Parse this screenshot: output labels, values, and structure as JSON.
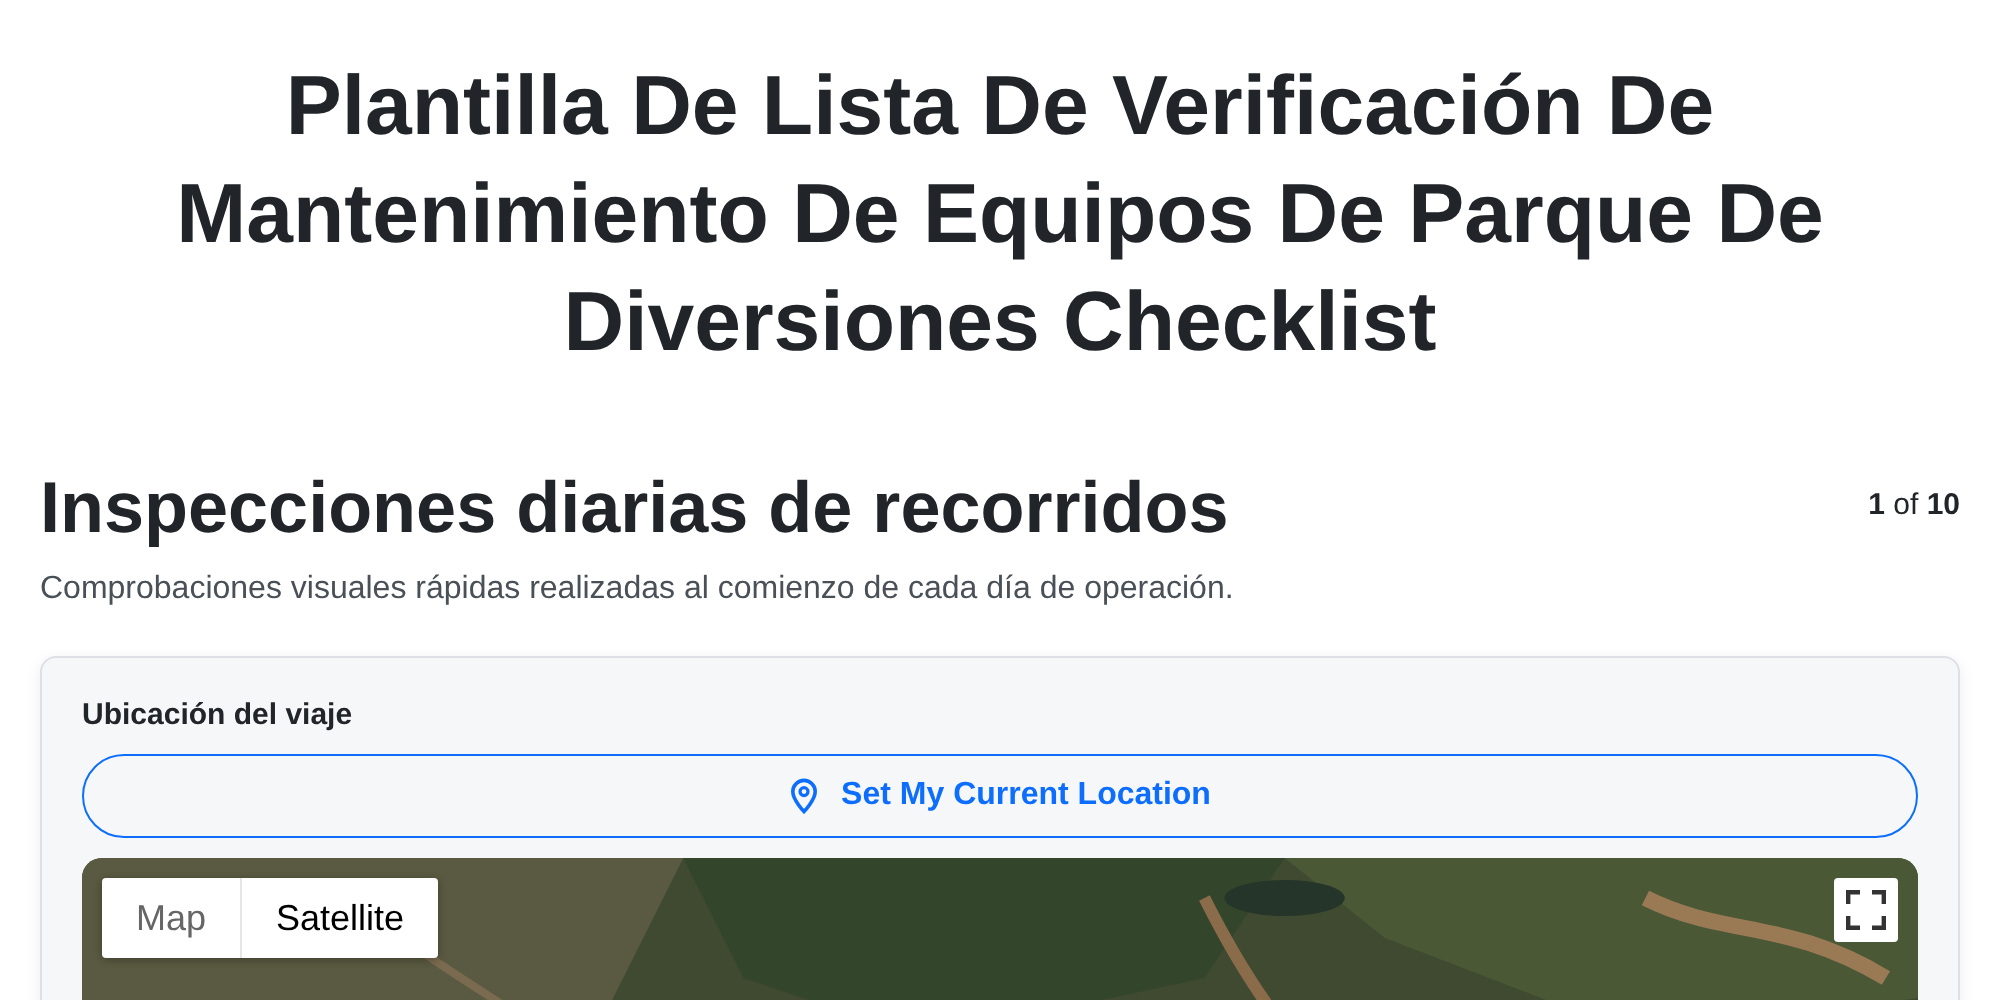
{
  "title": "Plantilla De Lista De Verificación De Mantenimiento De Equipos De Parque De Diversiones Checklist",
  "section": {
    "heading": "Inspecciones diarias de recorridos",
    "page_count": "**1** of **10**",
    "description": "Comprobaciones visuales rápidas realizadas al comienzo de cada día de operación."
  },
  "location_card": {
    "label": "Ubicación del viaje",
    "button": "Set My Current Location",
    "map": {
      "kind": "picture",
      "map_types": [
        {
          "label": "Map",
          "selected": false
        },
        {
          "label": "Satellite",
          "selected": true
        }
      ]
    }
  }
}
